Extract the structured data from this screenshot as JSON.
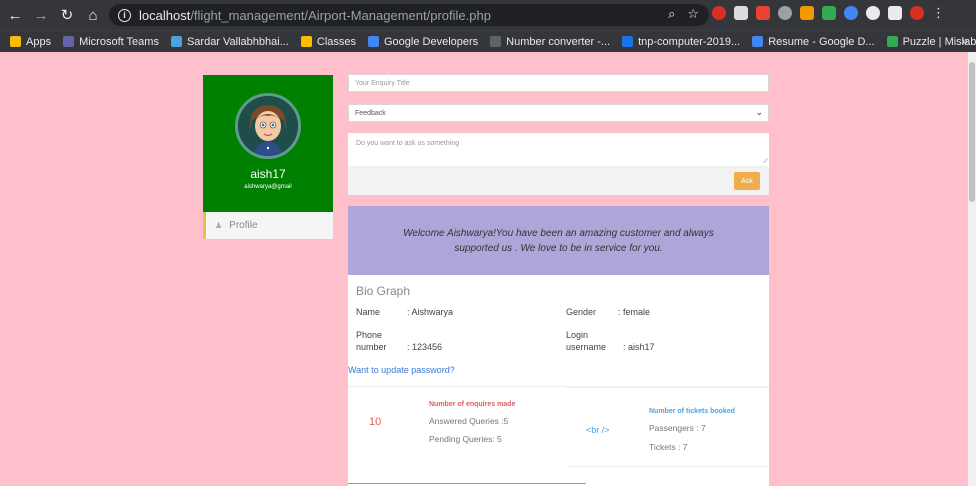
{
  "browser": {
    "url_host": "localhost",
    "url_path": "/flight_management/Airport-Management/profile.php",
    "bookmarks": [
      {
        "label": "Apps",
        "color": "#fbbc04"
      },
      {
        "label": "Microsoft Teams",
        "color": "#6264a7"
      },
      {
        "label": "Sardar Vallabhbhai...",
        "color": "#4aa3df"
      },
      {
        "label": "Classes",
        "color": "#fbbc04"
      },
      {
        "label": "Google Developers",
        "color": "#4285f4"
      },
      {
        "label": "Number converter -...",
        "color": "#202124"
      },
      {
        "label": "tnp-computer-2019...",
        "color": "#1a73e8"
      },
      {
        "label": "Resume - Google D...",
        "color": "#4285f4"
      },
      {
        "label": "Puzzle | Mislabeled...",
        "color": "#34a853"
      }
    ],
    "more_label": "»"
  },
  "profile": {
    "username": "aish17",
    "email": "aishwarya@gmail",
    "menu_item": "Profile"
  },
  "enquiry": {
    "title_placeholder": "Your Enquiry Title",
    "type_selected": "Feedback",
    "message_placeholder": "Do you want to ask us something",
    "ask_label": "Ask"
  },
  "welcome": {
    "text": "Welcome Aishwarya!You have been an amazing customer and always supported us . We love to be in service for you."
  },
  "bio": {
    "title": "Bio Graph",
    "name_label": "Name",
    "name_value": ": Aishwarya",
    "gender_label": "Gender",
    "gender_value": ": female",
    "phone_label_1": "Phone",
    "phone_label_2": "number",
    "phone_value": ": 123456",
    "login_label_1": "Login",
    "login_label_2": "username",
    "login_value": ": aish17",
    "update_password": "Want to update password?"
  },
  "stats": {
    "enquiries_count": "10",
    "enquiries_title": "Number of enquires made",
    "answered": "Answered Queries :5",
    "pending": "Pending Queries: 5",
    "br_text": "<br />",
    "tickets_title": "Number of tickets booked",
    "passengers": "Passengers : 7",
    "tickets": "Tickets : 7"
  },
  "colors": {
    "page_bg": "#ffc0cb",
    "profile_bg": "#008000",
    "banner_bg": "#b0a5d8",
    "ask_button": "#f0ad4e",
    "link": "#3a7bd5",
    "enquiry_accent": "#e05d5d",
    "ticket_accent": "#4aa3df"
  }
}
